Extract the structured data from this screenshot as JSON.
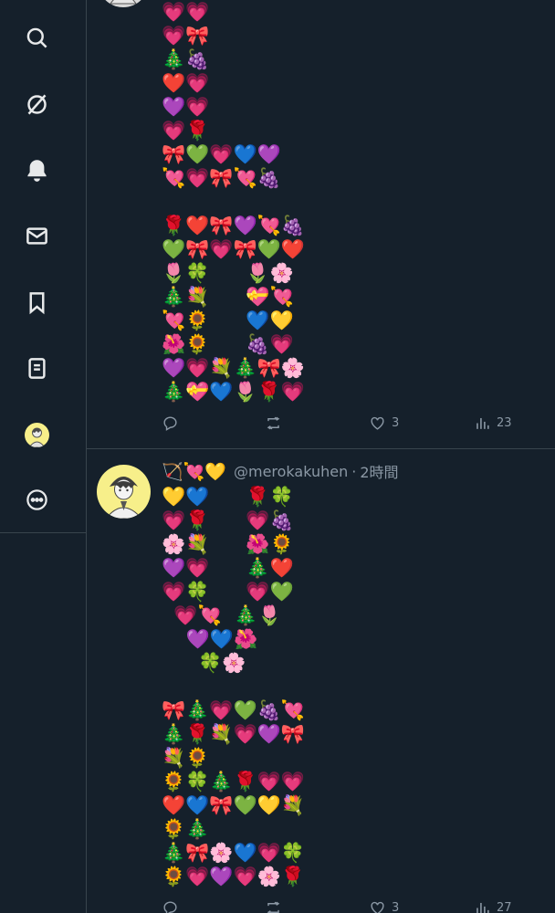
{
  "nav": {
    "items": [
      {
        "name": "search-icon"
      },
      {
        "name": "grok-icon"
      },
      {
        "name": "notifications-bell-icon"
      },
      {
        "name": "messages-mail-icon"
      },
      {
        "name": "bookmark-icon"
      },
      {
        "name": "lists-icon"
      },
      {
        "name": "profile-avatar"
      },
      {
        "name": "more-options-icon"
      }
    ]
  },
  "post1": {
    "emoji_rows": [
      "💗💗",
      "💗🎀",
      "🎄🍇",
      "❤️💗",
      "💜💗",
      "💗🌹",
      "🎀💚💗💙💜",
      "💘💗🎀💘🍇",
      "",
      "🌹❤️🎀💜💘🍇",
      "💚🎀💗🎀💚❤️",
      "🌷🍀      🌷🌸",
      "🎄💐      💝💘",
      "💘🌻      💙💛",
      "🌺🌻      🍇💗",
      "💜💗💐🎄🎀🌸",
      "🎄💝💙🌷🌹💗"
    ],
    "reply_count": "",
    "retweet_count": "",
    "like_count": "3",
    "view_count": "23"
  },
  "post2": {
    "header_emojis": "🏹💘💛",
    "handle": "@merokakuhen",
    "separator": "·",
    "time": "2時間",
    "emoji_rows": [
      "💛💙      🌹🍀",
      "💗🌹      💗🍇",
      "🌸💐      🌺🌻",
      "💜💗      🎄❤️",
      "💗🍀      💗💚",
      "  💗💘  🎄🌷",
      "    💜💙🌺",
      "      🍀🌸",
      "",
      "🎀🎄💗💚🍇💘",
      "🎄🌹💐💗💜🎀",
      "💐🌻",
      "🌻🍀🎄🌹💗💗",
      "❤️💙🎀💚💛💐",
      "🌻🎄",
      "🎄🎀🌸💙💗🍀",
      "🌻💗💜💗🌸🌹"
    ],
    "like_count": "3",
    "view_count": "27"
  },
  "colors": {
    "background": "#15202b",
    "divider": "#38444d",
    "secondary_text": "#8b98a5",
    "avatar_yellow": "#f7ef8a"
  }
}
